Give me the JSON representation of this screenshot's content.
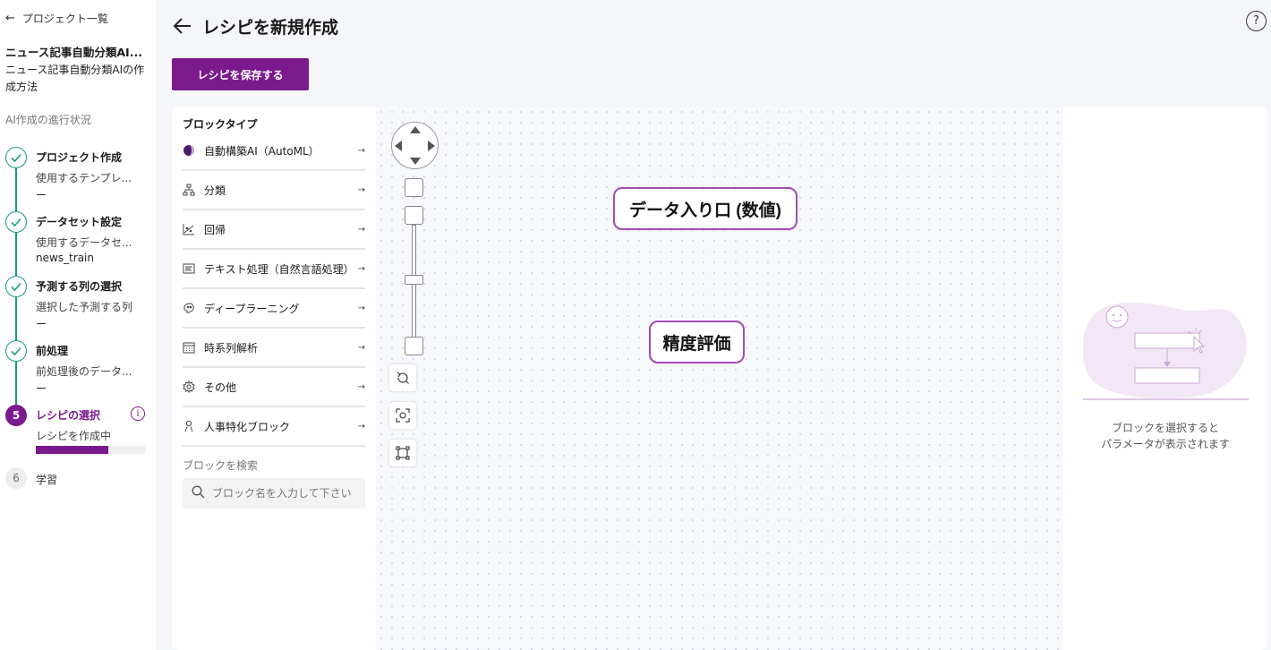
{
  "sidebar": {
    "back_label": "プロジェクト一覧",
    "project_name": "ニュース記事自動分類AI...",
    "project_desc": "ニュース記事自動分類AIの作成方法",
    "progress_title": "AI作成の進行状況",
    "steps": [
      {
        "title": "プロジェクト作成",
        "sub": "使用するテンプレ...",
        "value": "ー",
        "status": "done"
      },
      {
        "title": "データセット設定",
        "sub": "使用するデータセ...",
        "value": "news_train",
        "status": "done"
      },
      {
        "title": "予測する列の選択",
        "sub": "選択した予測する列",
        "value": "ー",
        "status": "done"
      },
      {
        "title": "前処理",
        "sub": "前処理後のデータ...",
        "value": "ー",
        "status": "done"
      },
      {
        "number": "5",
        "title": "レシピの選択",
        "sub": "レシピを作成中",
        "status": "current",
        "progress": 0.66,
        "info_symbol": "i"
      },
      {
        "number": "6",
        "title": "学習",
        "status": "future"
      }
    ]
  },
  "header": {
    "title": "レシピを新規作成",
    "save_button": "レシピを保存する",
    "help_symbol": "?"
  },
  "block_panel": {
    "title": "ブロックタイプ",
    "items": [
      {
        "label": "自動構築AI（AutoML）",
        "icon": "automl-icon"
      },
      {
        "label": "分類",
        "icon": "classification-icon"
      },
      {
        "label": "回帰",
        "icon": "regression-icon"
      },
      {
        "label": "テキスト処理（自然言語処理）",
        "icon": "text-processing-icon"
      },
      {
        "label": "ディープラーニング",
        "icon": "deep-learning-icon"
      },
      {
        "label": "時系列解析",
        "icon": "time-series-icon"
      },
      {
        "label": "その他",
        "icon": "gear-icon"
      },
      {
        "label": "人事特化ブロック",
        "icon": "person-icon"
      }
    ],
    "search_label": "ブロックを検索",
    "search_placeholder": "ブロック名を入力して下さい"
  },
  "canvas": {
    "nodes": [
      {
        "label": "データ入り口 (数値)"
      },
      {
        "label": "精度評価"
      }
    ]
  },
  "params_panel": {
    "line1": "ブロックを選択すると",
    "line2": "パラメータが表示されます"
  },
  "colors": {
    "accent": "#7a1a8c",
    "step_done": "#1a9a8c",
    "node_border": "#a34bb5"
  }
}
